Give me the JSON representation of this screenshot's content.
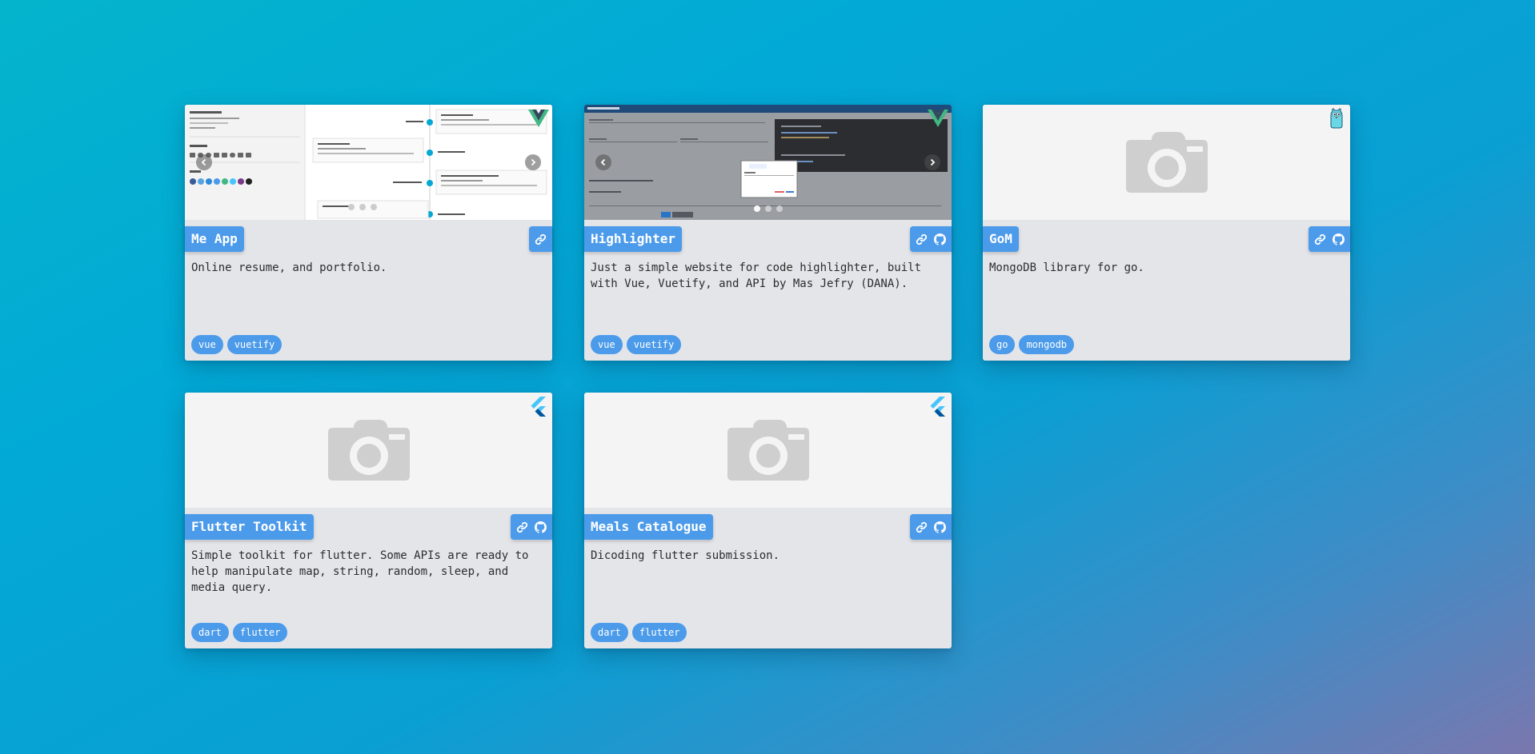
{
  "colors": {
    "accent": "#4c9bea",
    "card_bg": "#e4e5e9",
    "vue_green": "#41b883",
    "vue_dark": "#35495e",
    "flutter_blue": "#47c5fb",
    "flutter_dark": "#00569e"
  },
  "cards": [
    {
      "title": "Me App",
      "description": "Online resume, and portfolio.",
      "tags": [
        "vue",
        "vuetify"
      ],
      "tech_icon": "vue-logo-icon",
      "links": [
        "link-icon"
      ],
      "media": "screenshot-carousel"
    },
    {
      "title": "Highlighter",
      "description": "Just a simple website for code highlighter, built with Vue, Vuetify, and API by Mas Jefry (DANA).",
      "tags": [
        "vue",
        "vuetify"
      ],
      "tech_icon": "vue-logo-icon",
      "links": [
        "link-icon",
        "github-icon"
      ],
      "media": "screenshot-carousel"
    },
    {
      "title": "GoM",
      "description": "MongoDB library for go.",
      "tags": [
        "go",
        "mongodb"
      ],
      "tech_icon": "gopher-icon",
      "links": [
        "link-icon",
        "github-icon"
      ],
      "media": "camera-placeholder"
    },
    {
      "title": "Flutter Toolkit",
      "description": "Simple toolkit for flutter. Some APIs are ready to help manipulate map, string, random, sleep, and media query.",
      "tags": [
        "dart",
        "flutter"
      ],
      "tech_icon": "flutter-logo-icon",
      "links": [
        "link-icon",
        "github-icon"
      ],
      "media": "camera-placeholder"
    },
    {
      "title": "Meals Catalogue",
      "description": "Dicoding flutter submission.",
      "tags": [
        "dart",
        "flutter"
      ],
      "tech_icon": "flutter-logo-icon",
      "links": [
        "link-icon",
        "github-icon"
      ],
      "media": "camera-placeholder"
    }
  ]
}
